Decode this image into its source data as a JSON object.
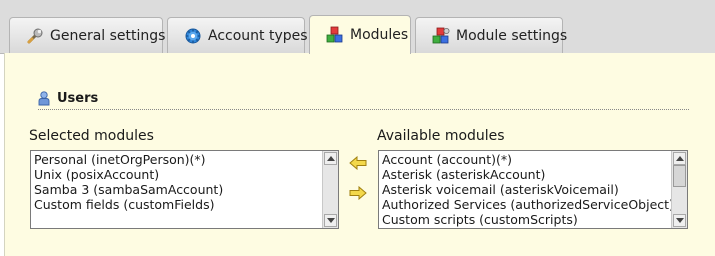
{
  "tabs": [
    {
      "label": "General settings",
      "icon": "wrench-icon",
      "active": false
    },
    {
      "label": "Account types",
      "icon": "gear-icon",
      "active": false
    },
    {
      "label": "Modules",
      "icon": "modules-icon",
      "active": true
    },
    {
      "label": "Module settings",
      "icon": "module-settings-icon",
      "active": false
    }
  ],
  "section": {
    "title": "Users",
    "icon": "user-icon"
  },
  "selected_modules": {
    "label": "Selected modules",
    "items": [
      "Personal (inetOrgPerson)(*)",
      "Unix (posixAccount)",
      "Samba 3 (sambaSamAccount)",
      "Custom fields (customFields)"
    ]
  },
  "available_modules": {
    "label": "Available modules",
    "items": [
      "Account (account)(*)",
      "Asterisk (asteriskAccount)",
      "Asterisk voicemail (asteriskVoicemail)",
      "Authorized Services (authorizedServiceObject)",
      "Custom scripts (customScripts)"
    ]
  },
  "colors": {
    "panel_background": "#fefce2",
    "tabbar_background": "#dcdcdc",
    "arrow_fill": "#f3d84a",
    "arrow_stroke": "#a08010"
  }
}
